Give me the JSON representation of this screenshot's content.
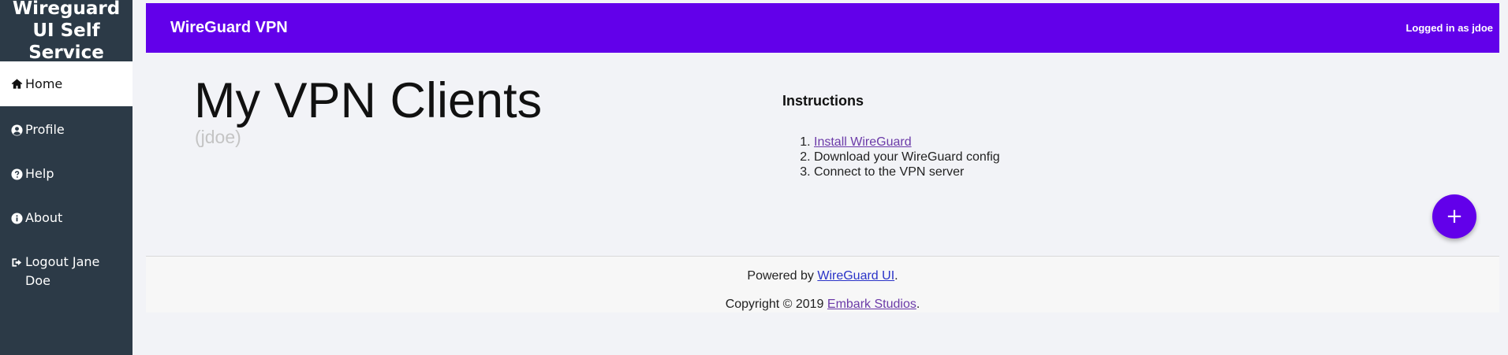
{
  "sidebar": {
    "brand": "Wireguard UI Self Service",
    "items": [
      {
        "label": "Home",
        "icon": "home-icon"
      },
      {
        "label": "Profile",
        "icon": "user-circle-icon"
      },
      {
        "label": "Help",
        "icon": "question-circle-icon"
      },
      {
        "label": "About",
        "icon": "info-circle-icon"
      },
      {
        "label": "Logout Jane Doe",
        "icon": "sign-out-icon"
      }
    ]
  },
  "header": {
    "title": "WireGuard VPN",
    "user_text": "Logged in as jdoe"
  },
  "main": {
    "title": "My VPN Clients",
    "subtitle": "(jdoe)",
    "instructions": {
      "heading": "Instructions",
      "steps": [
        "Install WireGuard",
        "Download your WireGuard config",
        "Connect to the VPN server"
      ]
    },
    "add_button": "+"
  },
  "footer": {
    "powered_prefix": "Powered by ",
    "powered_link": "WireGuard UI",
    "powered_suffix": ".",
    "copyright_prefix": "Copyright © 2019 ",
    "copyright_link": "Embark Studios",
    "copyright_suffix": "."
  },
  "colors": {
    "accent": "#6200ea",
    "sidebar": "#2c3a47",
    "link_blue": "#2a33c8",
    "link_visited": "#6b3aa8"
  }
}
